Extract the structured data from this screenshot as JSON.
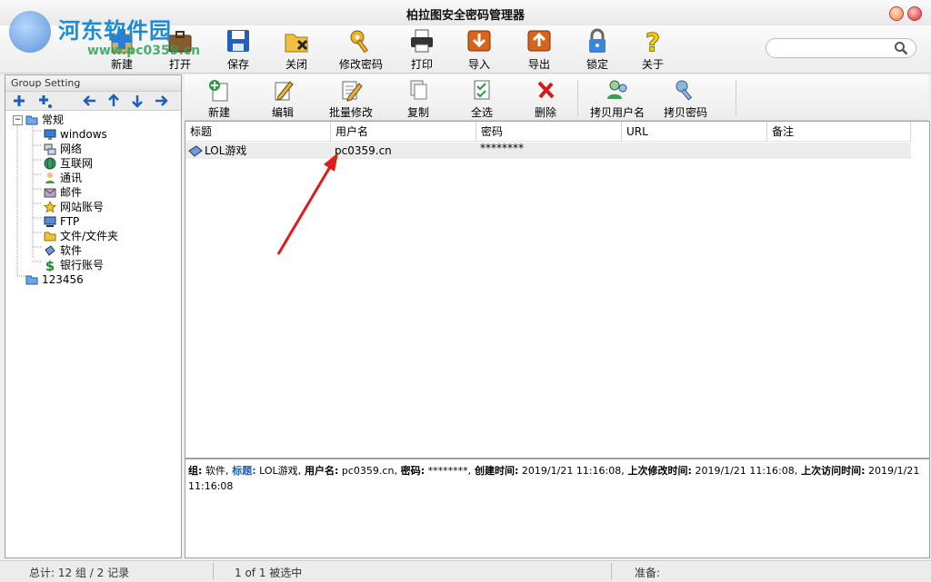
{
  "window": {
    "title": "柏拉图安全密码管理器"
  },
  "watermark": {
    "text": "河东软件园",
    "url": "www.pc0359.cn"
  },
  "toolbar": [
    {
      "label": "新建",
      "icon": "new-icon"
    },
    {
      "label": "打开",
      "icon": "open-icon"
    },
    {
      "label": "保存",
      "icon": "save-icon"
    },
    {
      "label": "关闭",
      "icon": "close-folder-icon"
    },
    {
      "label": "修改密码",
      "icon": "key-icon"
    },
    {
      "label": "打印",
      "icon": "printer-icon"
    },
    {
      "label": "导入",
      "icon": "import-icon"
    },
    {
      "label": "导出",
      "icon": "export-icon"
    },
    {
      "label": "锁定",
      "icon": "lock-icon"
    },
    {
      "label": "关于",
      "icon": "help-icon"
    }
  ],
  "search": {
    "placeholder": ""
  },
  "sidebar": {
    "header": "Group Setting",
    "tools": [
      "add-icon",
      "add-sub-icon",
      "arrow-left-icon",
      "arrow-up-icon",
      "arrow-down-icon",
      "arrow-right-icon"
    ],
    "tree": [
      {
        "label": "常规",
        "icon": "folder-icon",
        "level": 0
      },
      {
        "label": "windows",
        "icon": "monitor-icon",
        "level": 1
      },
      {
        "label": "网络",
        "icon": "network-icon",
        "level": 1
      },
      {
        "label": "互联网",
        "icon": "globe-icon",
        "level": 1
      },
      {
        "label": "通讯",
        "icon": "contact-icon",
        "level": 1
      },
      {
        "label": "邮件",
        "icon": "mail-icon",
        "level": 1
      },
      {
        "label": "网站账号",
        "icon": "star-icon",
        "level": 1
      },
      {
        "label": "FTP",
        "icon": "ftp-icon",
        "level": 1
      },
      {
        "label": "文件/文件夹",
        "icon": "file-folder-icon",
        "level": 1
      },
      {
        "label": "软件",
        "icon": "software-icon",
        "level": 1
      },
      {
        "label": "银行账号",
        "icon": "dollar-icon",
        "level": 1
      },
      {
        "label": "123456",
        "icon": "folder-icon",
        "level": 0
      }
    ]
  },
  "maintoolbar": [
    {
      "label": "新建",
      "icon": "new-entry-icon"
    },
    {
      "label": "编辑",
      "icon": "edit-icon"
    },
    {
      "label": "批量修改",
      "icon": "batch-edit-icon"
    },
    {
      "label": "复制",
      "icon": "copy-icon"
    },
    {
      "label": "全选",
      "icon": "select-all-icon"
    },
    {
      "label": "删除",
      "icon": "delete-icon"
    },
    {
      "label": "拷贝用户名",
      "icon": "copy-user-icon"
    },
    {
      "label": "拷贝密码",
      "icon": "copy-password-icon"
    }
  ],
  "grid": {
    "columns": [
      "标题",
      "用户名",
      "密码",
      "URL",
      "备注"
    ],
    "rows": [
      {
        "title": "LOL游戏",
        "username": "pc0359.cn",
        "password": "********",
        "url": "",
        "note": ""
      }
    ]
  },
  "detail": {
    "group_label": "组:",
    "group": " 软件,",
    "title_label": " 标题:",
    "title": " LOL游戏,",
    "user_label": " 用户名:",
    "user": " pc0359.cn,",
    "pw_label": " 密码:",
    "pw": " ********,",
    "created_label": " 创建时间:",
    "created": " 2019/1/21 11:16:08,",
    "modified_label": " 上次修改时间:",
    "modified": " 2019/1/21 11:16:08,",
    "accessed_label": " 上次访问时间:",
    "accessed": " 2019/1/21 11:16:08"
  },
  "status": {
    "total": "总计: 12 组 / 2 记录",
    "selection": "1 of 1 被选中",
    "state": "准备:"
  },
  "colors": {
    "accent": "#1e8ad6",
    "arrow": "#e01b1b",
    "row_bg": "#ececec"
  }
}
